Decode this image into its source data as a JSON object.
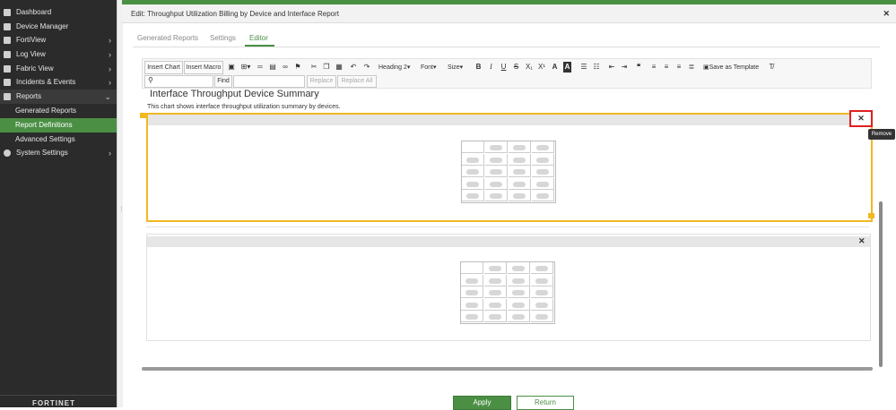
{
  "sidebar": {
    "items": [
      {
        "label": "Dashboard"
      },
      {
        "label": "Device Manager"
      },
      {
        "label": "FortiView"
      },
      {
        "label": "Log View"
      },
      {
        "label": "Fabric View"
      },
      {
        "label": "Incidents & Events"
      },
      {
        "label": "Reports"
      },
      {
        "label": "Generated Reports"
      },
      {
        "label": "Report Definitions"
      },
      {
        "label": "Advanced Settings"
      },
      {
        "label": "System Settings"
      }
    ],
    "logo": "FORTINET"
  },
  "dialog": {
    "title": "Edit: Throughput Utilization Billing by Device and Interface Report",
    "close": "✕"
  },
  "tabs": [
    "Generated Reports",
    "Settings",
    "Editor"
  ],
  "toolbar": {
    "insert_chart": "Insert Chart",
    "insert_macro": "Insert Macro",
    "heading": "Heading 2",
    "font": "Font",
    "size": "Size",
    "save_as_template": "Save as Template",
    "find": "Find",
    "replace": "Replace",
    "replace_all": "Replace All"
  },
  "content": {
    "section_title": "Interface Throughput Device Summary",
    "section_desc": "This chart shows interface throughput utilization summary by devices."
  },
  "remove_tooltip": "Remove",
  "buttons": {
    "apply": "Apply",
    "return": "Return"
  },
  "colors": {
    "accent": "#4a8f44",
    "selection": "#f1b822",
    "highlight": "#e02020"
  }
}
